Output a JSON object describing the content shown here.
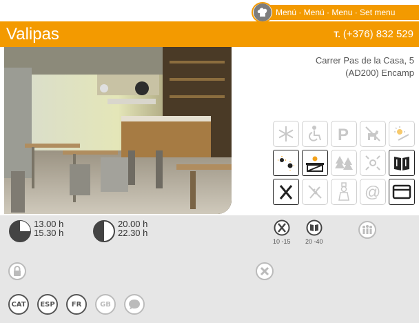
{
  "menu": {
    "icon": "chef-hat-icon",
    "label": "Menú · Menú · Menu · Set menu"
  },
  "restaurant": {
    "name": "Valipas",
    "phone_prefix": "T.",
    "phone": "(+376) 832 529",
    "address_line1": "Carrer Pas de la Casa, 5",
    "address_line2": "(AD200) Encamp"
  },
  "colors": {
    "accent": "#f39a00",
    "panel": "#e6e6e6",
    "active_icon": "#222222",
    "inactive_icon": "#cfcfcf"
  },
  "features": [
    {
      "icon": "snowflake-icon",
      "active": false
    },
    {
      "icon": "wheelchair-icon",
      "active": false
    },
    {
      "icon": "parking-icon",
      "active": false
    },
    {
      "icon": "no-dogs-icon",
      "active": false
    },
    {
      "icon": "sun-terrace-icon",
      "active": false
    },
    {
      "icon": "sunny-weather-icon",
      "active": true
    },
    {
      "icon": "terrace-view-icon",
      "active": true
    },
    {
      "icon": "forest-icon",
      "active": false
    },
    {
      "icon": "center-view-icon",
      "active": false
    },
    {
      "icon": "menu-book-icon",
      "active": true
    },
    {
      "icon": "fork-knife-icon",
      "active": true
    },
    {
      "icon": "celiac-icon",
      "active": false
    },
    {
      "icon": "chef-icon",
      "active": false
    },
    {
      "icon": "at-sign-icon",
      "active": false
    },
    {
      "icon": "credit-card-icon",
      "active": true
    }
  ],
  "schedule": {
    "lunch_open": "13.00 h",
    "lunch_close": "15.30 h",
    "dinner_open": "20.00 h",
    "dinner_close": "22.30 h"
  },
  "prices": {
    "menu_price": "10 -15",
    "carta_price": "20 -40"
  },
  "languages": [
    {
      "code": "CAT",
      "active": true
    },
    {
      "code": "ESP",
      "active": true
    },
    {
      "code": "FR",
      "active": true
    },
    {
      "code": "GB",
      "active": false
    }
  ]
}
